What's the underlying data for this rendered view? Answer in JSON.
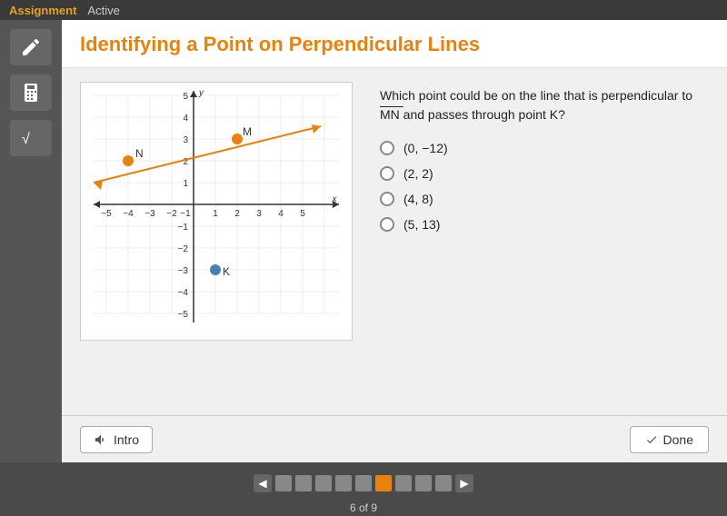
{
  "topbar": {
    "assignment_label": "Assignment",
    "active_label": "Active"
  },
  "header": {
    "title": "Identifying a Point on Perpendicular Lines"
  },
  "question": {
    "text_part1": "Which point could be on the line that is perpendicular to",
    "mn_label": "MN",
    "text_part2": "and passes through point K?",
    "options": [
      {
        "label": "(0, −12)",
        "id": "opt1"
      },
      {
        "label": "(2, 2)",
        "id": "opt2"
      },
      {
        "label": "(4, 8)",
        "id": "opt3"
      },
      {
        "label": "(5, 13)",
        "id": "opt4"
      }
    ]
  },
  "buttons": {
    "intro": "Intro",
    "done": "Done"
  },
  "pagination": {
    "current": 6,
    "total": 9,
    "label": "6 of 9",
    "pages": [
      1,
      2,
      3,
      4,
      5,
      6,
      7,
      8,
      9
    ],
    "active_page": 6
  },
  "icons": {
    "pencil": "✏",
    "calculator": "🔢",
    "formula": "√",
    "volume": "🔊",
    "check": "✓",
    "prev": "◀",
    "next": "▶"
  }
}
